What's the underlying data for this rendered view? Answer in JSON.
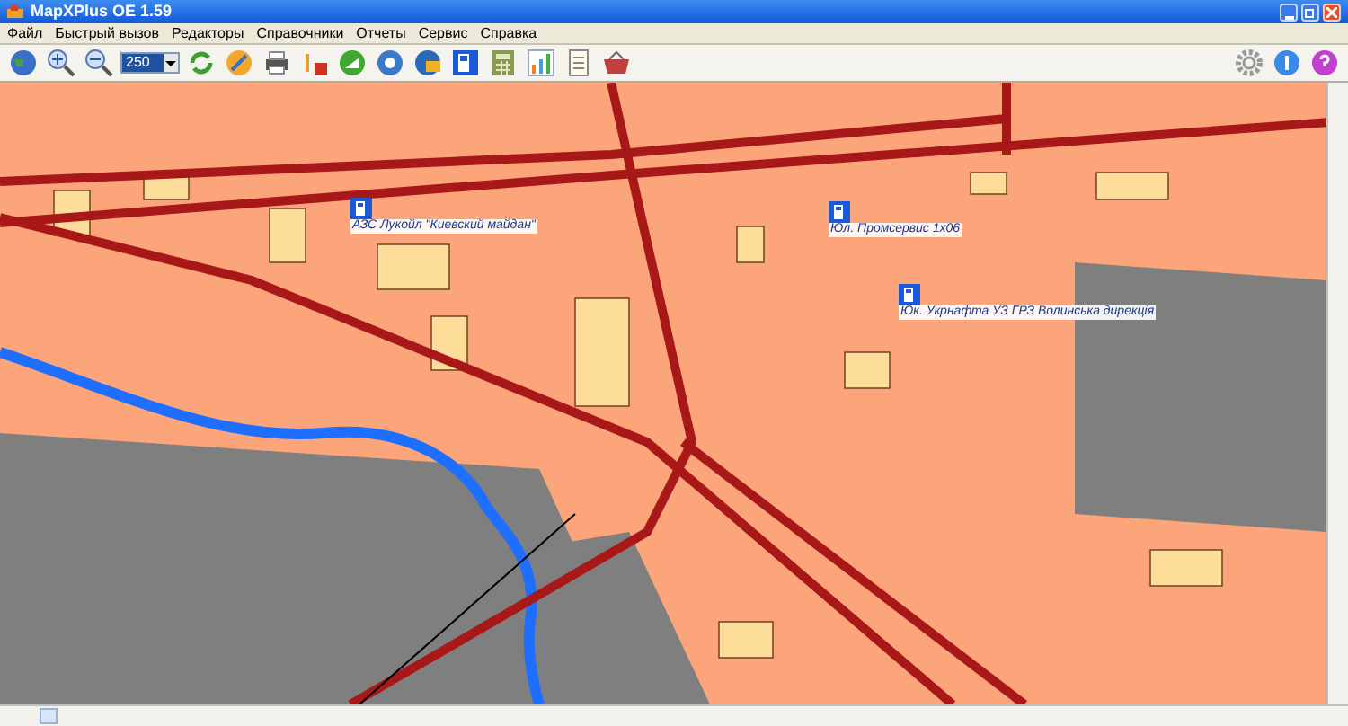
{
  "window": {
    "title": "MapXPlus OE 1.59"
  },
  "menu": [
    "Файл",
    "Быстрый вызов",
    "Редакторы",
    "Справочники",
    "Отчеты",
    "Сервис",
    "Справка"
  ],
  "toolbar": {
    "scale": "250"
  },
  "map": {
    "labels": [
      {
        "text": "АЗС Лукойл \"Киевский майдан\""
      },
      {
        "text": "Юл. Промсервис 1х06"
      },
      {
        "text": "Юк. Укрнафта УЗ ГРЗ Волинська дирекція"
      }
    ]
  }
}
